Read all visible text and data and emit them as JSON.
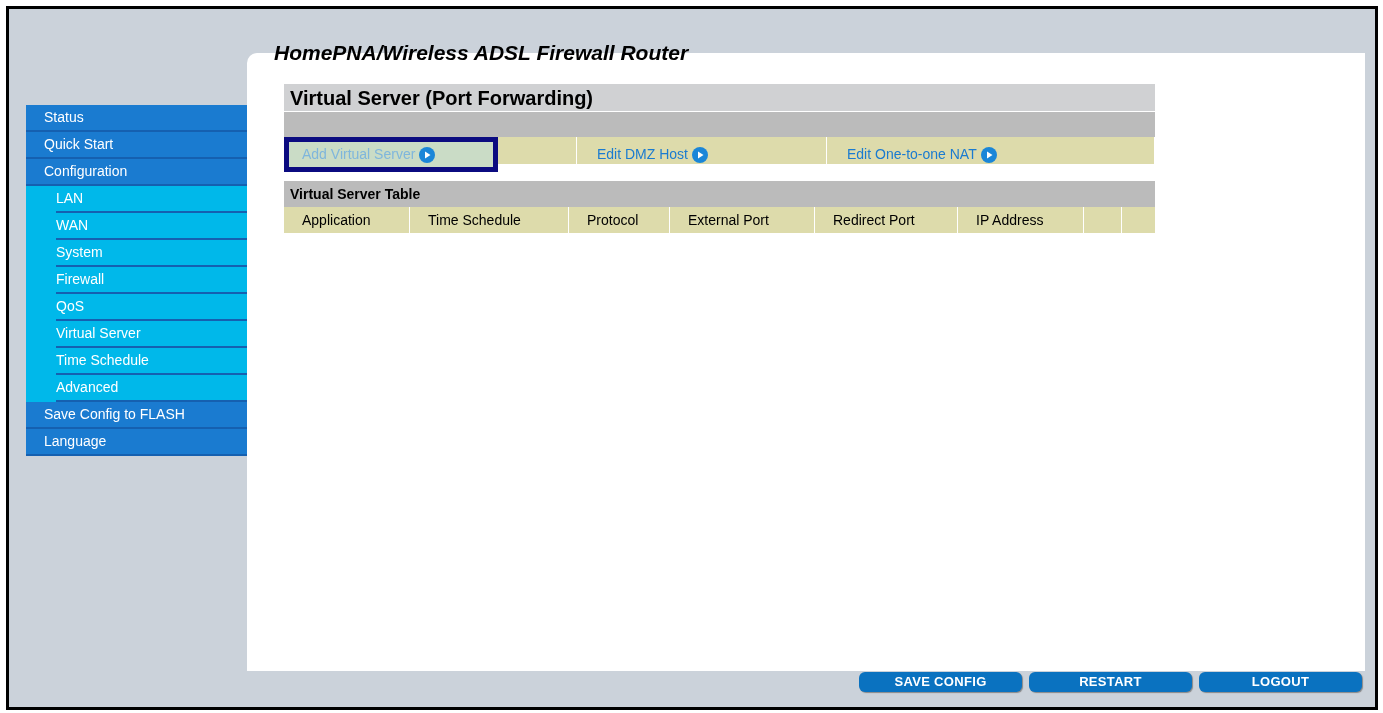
{
  "header": {
    "title": "HomePNA/Wireless ADSL Firewall Router"
  },
  "sidebar": {
    "items": [
      {
        "label": "Status",
        "selected": false
      },
      {
        "label": "Quick Start",
        "selected": false
      },
      {
        "label": "Configuration",
        "selected": false,
        "children": [
          {
            "label": "LAN",
            "selected": false
          },
          {
            "label": "WAN",
            "selected": false
          },
          {
            "label": "System",
            "selected": false
          },
          {
            "label": "Firewall",
            "selected": false
          },
          {
            "label": "QoS",
            "selected": false
          },
          {
            "label": "Virtual Server",
            "selected": false
          },
          {
            "label": "Time Schedule",
            "selected": false
          },
          {
            "label": "Advanced",
            "selected": false
          }
        ]
      },
      {
        "label": "Save Config to FLASH",
        "selected": false
      },
      {
        "label": "Language",
        "selected": false
      }
    ]
  },
  "page": {
    "title": "Virtual Server (Port Forwarding)",
    "actions": [
      {
        "label": "Add Virtual Server",
        "selected": true
      },
      {
        "label": "Edit DMZ Host",
        "selected": false
      },
      {
        "label": "Edit One-to-one NAT",
        "selected": false
      }
    ],
    "table": {
      "title": "Virtual Server Table",
      "columns": [
        "Application",
        "Time Schedule",
        "Protocol",
        "External Port",
        "Redirect Port",
        "IP Address"
      ]
    }
  },
  "footer_buttons": [
    "SAVE CONFIG",
    "RESTART",
    "LOGOUT"
  ]
}
